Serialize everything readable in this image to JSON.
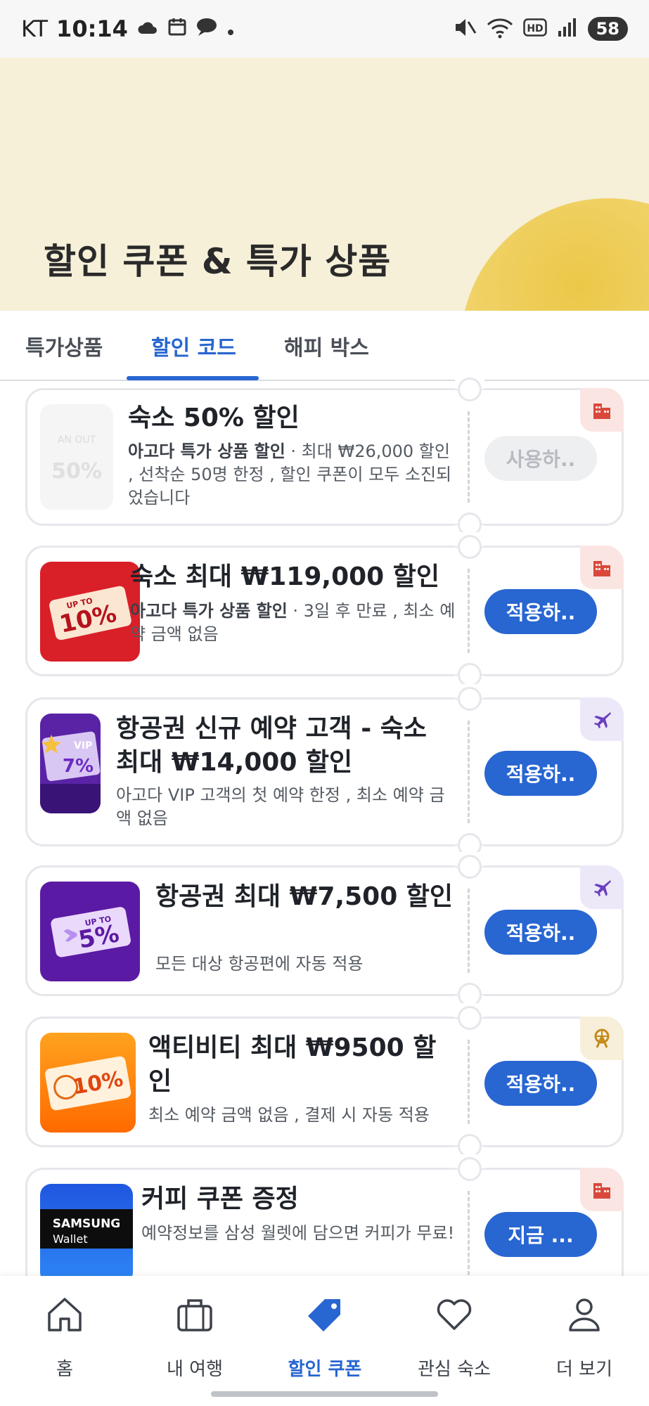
{
  "status_bar": {
    "carrier": "KT",
    "time": "10:14",
    "battery": "58"
  },
  "hero": {
    "title": "할인 쿠폰 & 특가 상품"
  },
  "tabs": [
    {
      "label": "특가상품"
    },
    {
      "label": "할인 코드"
    },
    {
      "label": "해피 박스"
    }
  ],
  "coupons": [
    {
      "title": "숙소 50% 할인",
      "desc_bold": "아고다 특가 상품 할인",
      "desc_rest": " · 최대 ₩26,000 할인 , 선착순 50명 한정 , 할인 쿠폰이 모두 소진되었습니다",
      "button": "사용하..",
      "category": "hotel-icon",
      "thumb_text": "50%"
    },
    {
      "title": "숙소 최대 ₩119,000 할인",
      "desc_bold": "아고다 특가 상품 할인",
      "desc_rest": " · 3일 후 만료 , 최소 예약 금액 없음",
      "button": "적용하..",
      "category": "hotel-icon",
      "thumb_text": "10%"
    },
    {
      "title": "항공권 신규 예약 고객 - 숙소 최대 ₩14,000 할인",
      "desc_bold": "",
      "desc_rest": "아고다 VIP 고객의 첫 예약 한정 , 최소 예약 금액 없음",
      "button": "적용하..",
      "category": "flight-icon",
      "thumb_text": "7%"
    },
    {
      "title": "항공권 최대 ₩7,500 할인",
      "desc_bold": "",
      "desc_rest": "모든 대상 항공편에 자동 적용",
      "button": "적용하..",
      "category": "flight-icon",
      "thumb_text": "5%"
    },
    {
      "title": "액티비티 최대 ₩9500 할인",
      "desc_bold": "",
      "desc_rest": "최소 예약 금액 없음 , 결제 시 자동 적용",
      "button": "적용하..",
      "category": "ferris-wheel-icon",
      "thumb_text": "10%"
    },
    {
      "title": "커피 쿠폰 증정",
      "desc_bold": "",
      "desc_rest": "예약정보를 삼성 월렛에 담으면 커피가 무료!",
      "button": "지금 ...",
      "category": "hotel-icon",
      "thumb_text": "SAMSUNG",
      "thumb_sub": "Wallet"
    }
  ],
  "bottom_nav": [
    {
      "label": "홈",
      "icon": "home-icon"
    },
    {
      "label": "내 여행",
      "icon": "suitcase-icon"
    },
    {
      "label": "할인 쿠폰",
      "icon": "tag-icon"
    },
    {
      "label": "관심 숙소",
      "icon": "heart-icon"
    },
    {
      "label": "더 보기",
      "icon": "profile-icon"
    }
  ],
  "colors": {
    "accent": "#2866d1",
    "hero_bg": "#f6f0d9",
    "sun": "#ecc848"
  }
}
